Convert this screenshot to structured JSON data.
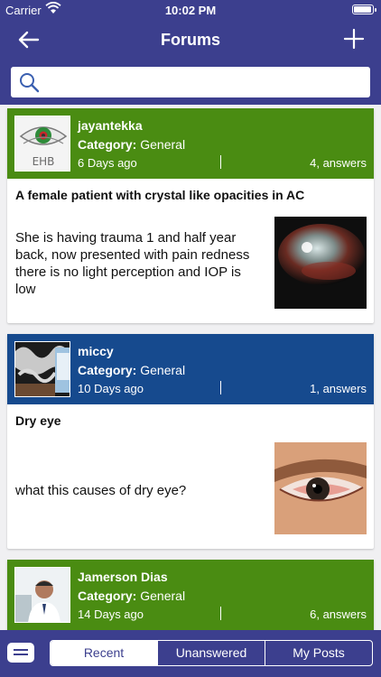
{
  "status": {
    "carrier": "Carrier",
    "time": "10:02 PM"
  },
  "nav": {
    "title": "Forums"
  },
  "search": {
    "placeholder": ""
  },
  "posts": [
    {
      "user": "jayantekka",
      "category_label": "Category:",
      "category": "General",
      "age": "6 Days ago",
      "answers": "4, answers",
      "title": "A female patient with crystal like opacities in AC",
      "text": "She is having trauma 1 and half year back, now presented with pain redness there is no light perception and IOP is low",
      "color": "#4a8c12",
      "avatar_text": "EHB"
    },
    {
      "user": "miccy",
      "category_label": "Category:",
      "category": "General",
      "age": "10 Days ago",
      "answers": "1, answers",
      "title": "Dry eye",
      "text": "what this causes of dry eye?",
      "color": "#164a8e"
    },
    {
      "user": "Jamerson Dias",
      "category_label": "Category:",
      "category": "General",
      "age": "14 Days ago",
      "answers": "6, answers",
      "color": "#4a8c12"
    }
  ],
  "tabs": {
    "recent": "Recent",
    "unanswered": "Unanswered",
    "my_posts": "My Posts"
  },
  "colors": {
    "nav": "#3c3f8e",
    "green": "#4a8c12",
    "blue": "#164a8e"
  }
}
